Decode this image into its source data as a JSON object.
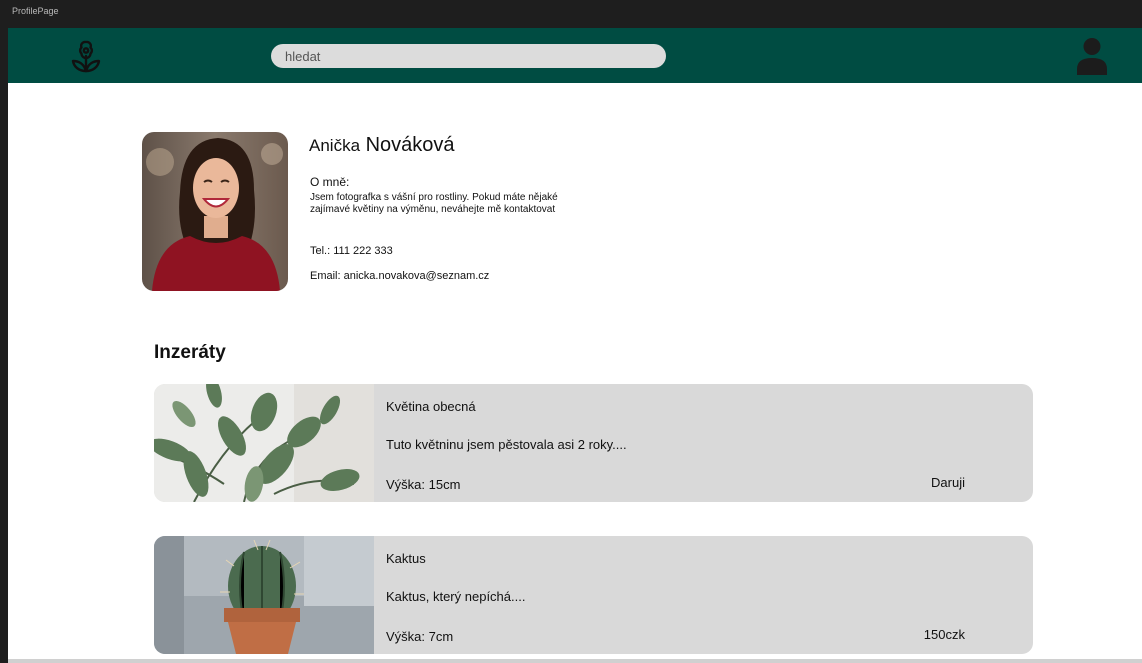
{
  "window": {
    "title": "ProfilePage"
  },
  "header": {
    "search_placeholder": "hledat",
    "logo_icon": "flower-icon",
    "user_icon": "user-icon",
    "background_color": "#004c42"
  },
  "profile": {
    "first_name": "Anička",
    "last_name": "Nováková",
    "about_heading": "O mně:",
    "about_text": "Jsem fotografka s vášní pro rostliny. Pokud máte nějaké zajímavé květiny na výměnu, neváhejte mě kontaktovat",
    "phone": "Tel.: 111 222 333",
    "email": "Email: anicka.novakova@seznam.cz"
  },
  "listings_section": {
    "title": "Inzeráty",
    "items": [
      {
        "title": "Květina obecná",
        "description": "Tuto květninu jsem pěstovala asi 2 roky....",
        "height": "Výška: 15cm",
        "price": "Daruji"
      },
      {
        "title": "Kaktus",
        "description": "Kaktus, který nepíchá....",
        "height": "Výška: 7cm",
        "price": "150czk"
      }
    ]
  }
}
